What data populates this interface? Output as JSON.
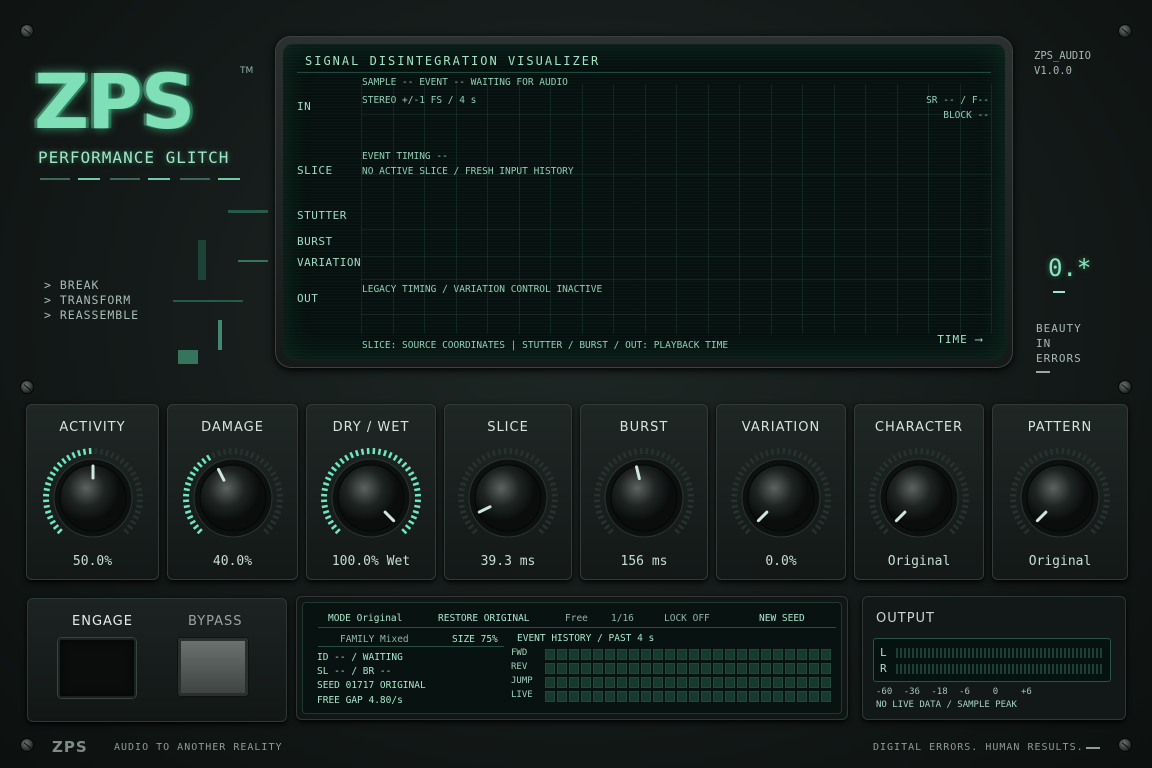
{
  "brand": {
    "logo": "ZPS",
    "tm": "TM",
    "subtitle": "PERFORMANCE GLITCH",
    "menu": [
      "> BREAK",
      "> TRANSFORM",
      "> REASSEMBLE"
    ],
    "version_name": "ZPS_AUDIO",
    "version": "V1.0.0",
    "zero": "0.*",
    "tagline_lines": [
      "BEAUTY",
      "IN",
      "ERRORS"
    ]
  },
  "visualizer": {
    "title": "SIGNAL DISINTEGRATION VISUALIZER",
    "lanes": [
      "IN",
      "SLICE",
      "STUTTER",
      "BURST",
      "VARIATION",
      "OUT"
    ],
    "sample_event": "SAMPLE --   EVENT --   WAITING FOR AUDIO",
    "stereo": "STEREO +/-1 FS / 4 s",
    "sr": "SR -- / F--",
    "block": "BLOCK --",
    "event_timing": "EVENT TIMING --",
    "no_active": "NO ACTIVE SLICE / FRESH INPUT HISTORY",
    "legacy": "LEGACY TIMING / VARIATION CONTROL INACTIVE",
    "footer": "SLICE: SOURCE COORDINATES | STUTTER / BURST / OUT: PLAYBACK TIME",
    "time": "TIME",
    "time_arrow": "⟶"
  },
  "knobs": [
    {
      "label": "ACTIVITY",
      "value": "50.0%",
      "fill": 0.5,
      "color": "#6ee6c0",
      "lit": true
    },
    {
      "label": "DAMAGE",
      "value": "40.0%",
      "fill": 0.4,
      "color": "#6ee6c0",
      "lit": true
    },
    {
      "label": "DRY / WET",
      "value": "100.0% Wet",
      "fill": 1.0,
      "color": "#6ee6c0",
      "lit": true
    },
    {
      "label": "SLICE",
      "value": "39.3 ms",
      "fill": 0.07,
      "color": "#6ee6c0",
      "lit": false
    },
    {
      "label": "BURST",
      "value": "156 ms",
      "fill": 0.45,
      "color": "#6ee6c0",
      "lit": false
    },
    {
      "label": "VARIATION",
      "value": "0.0%",
      "fill": 0.0,
      "color": "#6ee6c0",
      "lit": false
    },
    {
      "label": "CHARACTER",
      "value": "Original",
      "fill": 0.0,
      "color": "#6ee6c0",
      "lit": false
    },
    {
      "label": "PATTERN",
      "value": "Original",
      "fill": 0.0,
      "color": "#6ee6c0",
      "lit": false
    }
  ],
  "transport": {
    "engage": "ENGAGE",
    "bypass": "BYPASS"
  },
  "panel": {
    "mode": "MODE Original",
    "restore": "RESTORE ORIGINAL",
    "free": "Free",
    "division": "1/16",
    "lock": "LOCK OFF",
    "new_seed": "NEW SEED",
    "family": "FAMILY Mixed",
    "size": "SIZE 75%",
    "event_history": "EVENT HISTORY / PAST 4 s",
    "id": "ID -- / WAITING",
    "sl": "SL -- / BR --",
    "seed": "SEED 01717 ORIGINAL",
    "gap": "FREE GAP 4.80/s",
    "history_rows": [
      "FWD",
      "REV",
      "JUMP",
      "LIVE"
    ]
  },
  "output": {
    "title": "OUTPUT",
    "channels": [
      "L",
      "R"
    ],
    "scale": [
      "-60",
      "-36",
      "-18",
      "-6",
      "0",
      "+6"
    ],
    "status": "NO LIVE DATA / SAMPLE PEAK"
  },
  "footer": {
    "logo": "ZPS",
    "tagline": "AUDIO TO ANOTHER REALITY",
    "right": "DIGITAL ERRORS. HUMAN RESULTS."
  }
}
